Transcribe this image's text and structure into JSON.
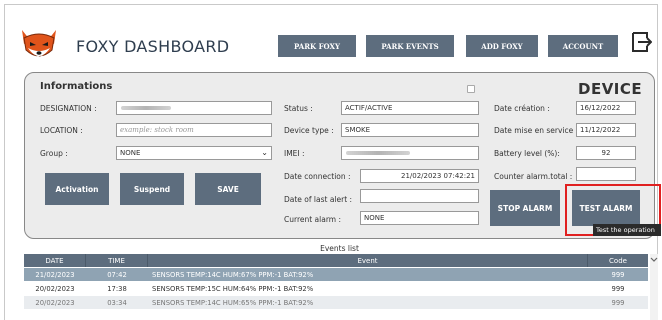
{
  "header": {
    "brand": "FOXY DASHBOARD",
    "nav": [
      "PARK FOXY",
      "PARK EVENTS",
      "ADD FOXY",
      "ACCOUNT"
    ]
  },
  "informations": {
    "title": "Informations",
    "designation_label": "DESIGNATION :",
    "location_label": "LOCATION :",
    "location_placeholder": "example: stock room",
    "group_label": "Group :",
    "group_value": "NONE"
  },
  "status": {
    "status_label": "Status :",
    "status_value": "ACTIF/ACTIVE",
    "device_type_label": "Device type :",
    "device_type_value": "SMOKE",
    "imei_label": "IMEI :",
    "date_connection_label": "Date connection :",
    "date_connection_value": "21/02/2023 07:42:21",
    "last_alert_label": "Date of last alert :",
    "last_alert_value": "",
    "current_alarm_label": "Current alarm :",
    "current_alarm_value": "NONE"
  },
  "device": {
    "title": "DEVICE",
    "creation_label": "Date création :",
    "creation_value": "16/12/2022",
    "service_label": "Date mise en service :",
    "service_value": "11/12/2022",
    "battery_label": "Battery level (%):",
    "battery_value": "92",
    "counter_label": "Counter alarm.total :",
    "counter_value": ""
  },
  "actions": {
    "activation": "Activation",
    "suspend": "Suspend",
    "save": "SAVE",
    "stop_alarm": "STOP ALARM",
    "test_alarm": "TEST ALARM",
    "tooltip": "Test the operation"
  },
  "events": {
    "title": "Events list",
    "columns": [
      "DATE",
      "TIME",
      "Event",
      "Code"
    ],
    "rows": [
      {
        "date": "21/02/2023",
        "time": "07:42",
        "event": "SENSORS TEMP:14C HUM:67% PPM:-1 BAT:92%",
        "code": "999"
      },
      {
        "date": "20/02/2023",
        "time": "17:38",
        "event": "SENSORS TEMP:15C HUM:64% PPM:-1 BAT:92%",
        "code": "999"
      },
      {
        "date": "20/02/2023",
        "time": "03:34",
        "event": "SENSORS TEMP:14C HUM:65% PPM:-1 BAT:92%",
        "code": "999"
      }
    ]
  },
  "colors": {
    "button": "#5d6d7e",
    "selected_row": "#8fa3b3",
    "highlight": "#e02020"
  },
  "icons": [
    "fox-logo-icon",
    "exit-icon",
    "checkbox-icon",
    "chevron-down-icon"
  ]
}
